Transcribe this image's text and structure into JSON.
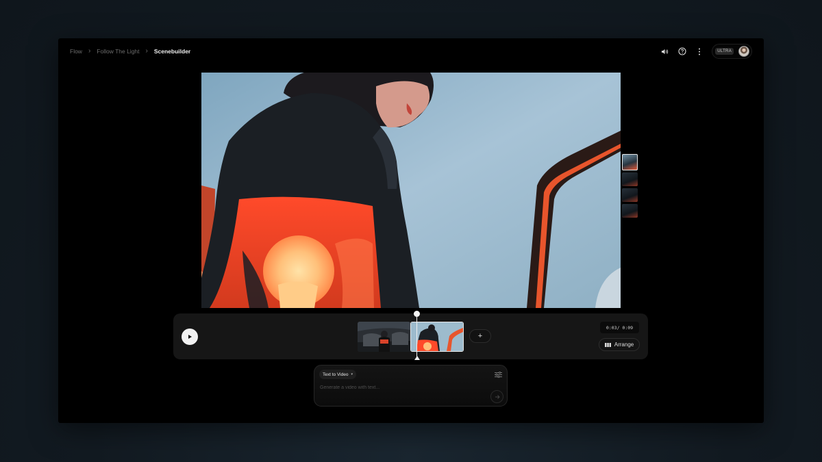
{
  "breadcrumb": {
    "items": [
      "Flow",
      "Follow The Light"
    ],
    "current": "Scenebuilder"
  },
  "header": {
    "icons": [
      "volume-icon",
      "help-icon",
      "more-vert-icon"
    ],
    "plan_badge": "ULTRA"
  },
  "clips": {
    "count": 4,
    "active_index": 0
  },
  "timeline": {
    "time": "0:03/ 0:09",
    "add_label": "+",
    "arrange_label": "Arrange"
  },
  "prompt": {
    "mode": "Text to Video",
    "placeholder": "Generate a video with text..."
  },
  "colors": {
    "accent_red": "#e8452a",
    "sky": "#a9c6d8",
    "panel": "#161616"
  }
}
